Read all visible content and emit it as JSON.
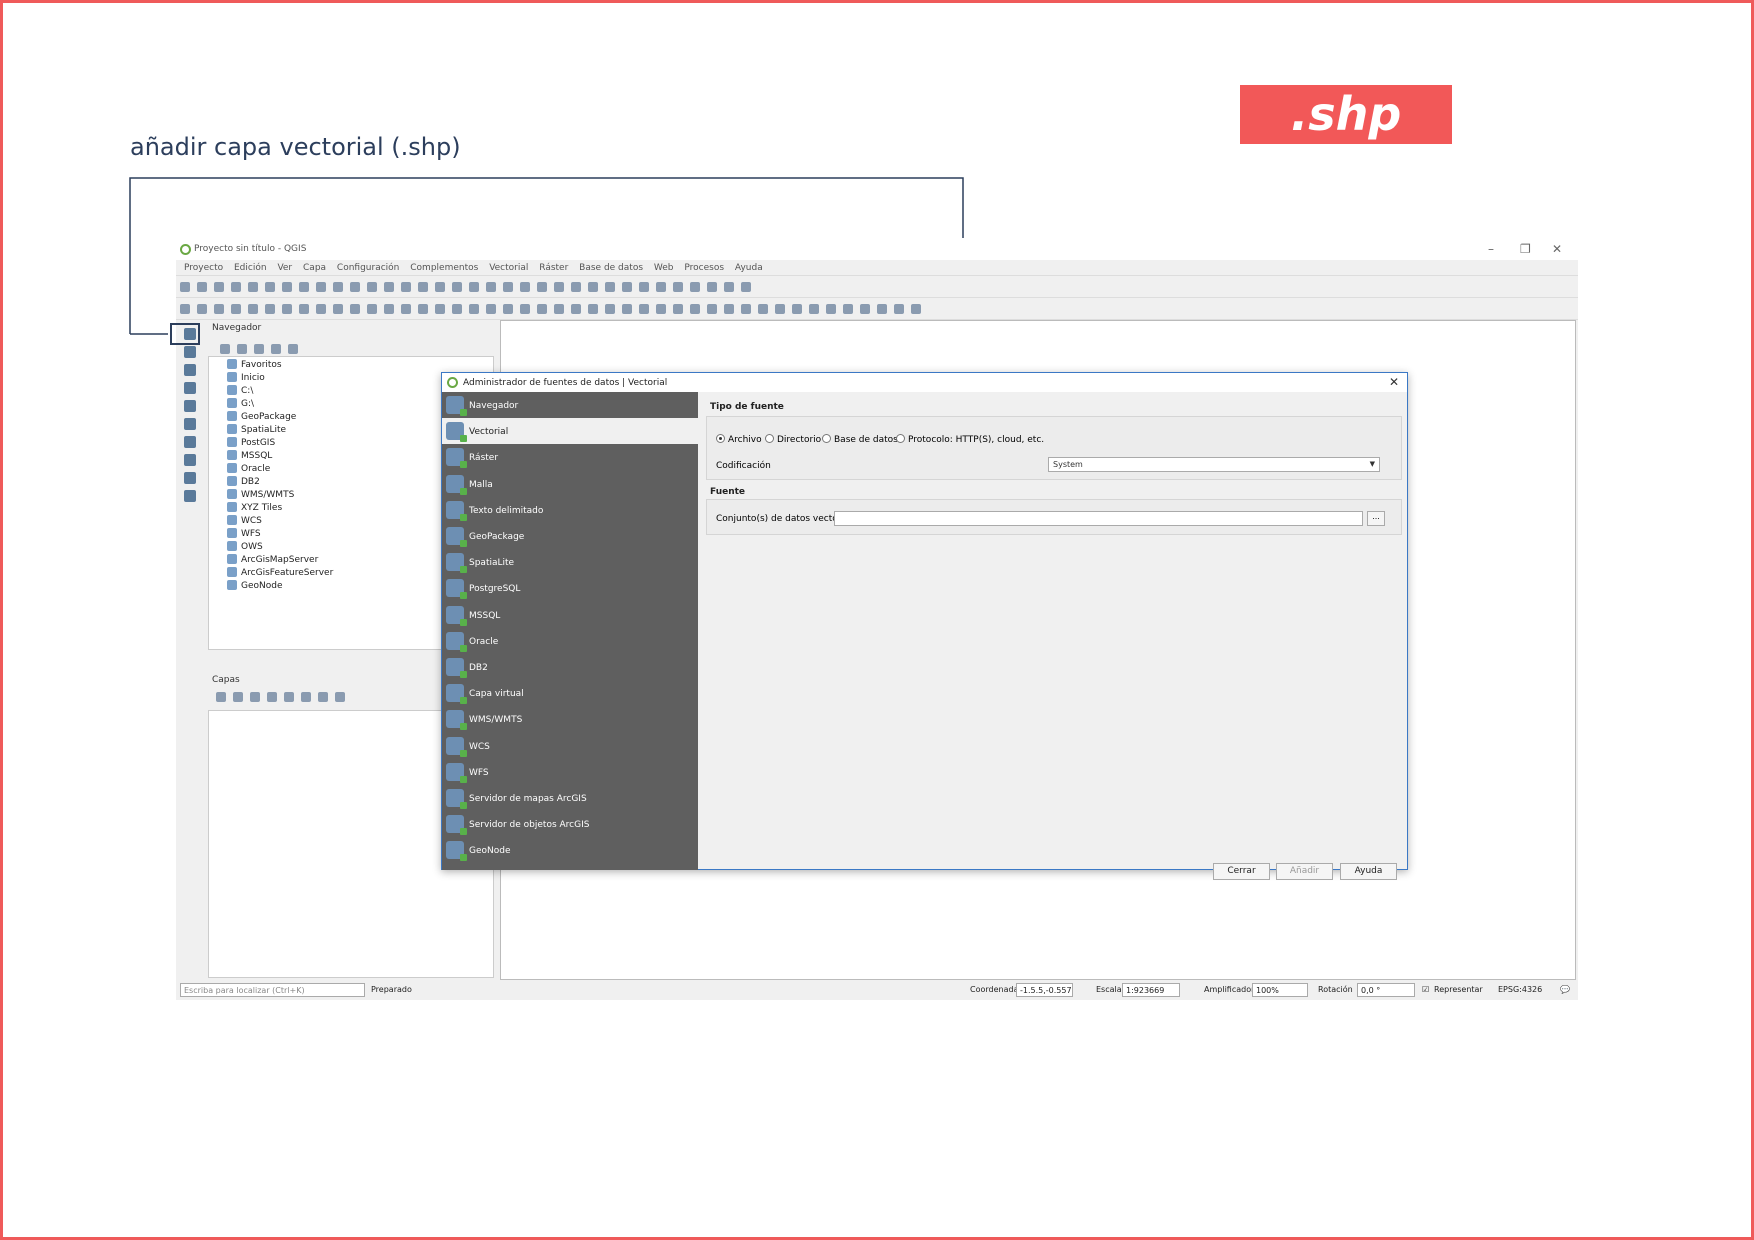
{
  "heading": "añadir capa vectorial (.shp)",
  "badge": ".shp",
  "window": {
    "title": "Proyecto sin título - QGIS",
    "menu": [
      "Proyecto",
      "Edición",
      "Ver",
      "Capa",
      "Configuración",
      "Complementos",
      "Vectorial",
      "Ráster",
      "Base de datos",
      "Web",
      "Procesos",
      "Ayuda"
    ]
  },
  "browser": {
    "title": "Navegador",
    "items": [
      "Favoritos",
      "Inicio",
      "C:\\",
      "G:\\",
      "GeoPackage",
      "SpatiaLite",
      "PostGIS",
      "MSSQL",
      "Oracle",
      "DB2",
      "WMS/WMTS",
      "XYZ Tiles",
      "WCS",
      "WFS",
      "OWS",
      "ArcGisMapServer",
      "ArcGisFeatureServer",
      "GeoNode"
    ]
  },
  "layers": {
    "title": "Capas"
  },
  "status": {
    "search_placeholder": "Escriba para localizar (Ctrl+K)",
    "state": "Preparado",
    "coord_label": "Coordenada",
    "coord_value": "-1.5.5,-0.557",
    "scale_label": "Escala",
    "scale_value": "1:923669",
    "magnifier_label": "Amplificador",
    "magnifier_value": "100%",
    "rotation_label": "Rotación",
    "rotation_value": "0,0 °",
    "render_label": "Representar",
    "crs": "EPSG:4326"
  },
  "dialog": {
    "title": "Administrador de fuentes de datos | Vectorial",
    "sidebar": [
      "Navegador",
      "Vectorial",
      "Ráster",
      "Malla",
      "Texto delimitado",
      "GeoPackage",
      "SpatiaLite",
      "PostgreSQL",
      "MSSQL",
      "Oracle",
      "DB2",
      "Capa virtual",
      "WMS/WMTS",
      "WCS",
      "WFS",
      "Servidor de mapas ArcGIS",
      "Servidor de objetos ArcGIS",
      "GeoNode"
    ],
    "source_type_header": "Tipo de fuente",
    "radio_file": "Archivo",
    "radio_dir": "Directorio",
    "radio_db": "Base de datos",
    "radio_proto": "Protocolo: HTTP(S), cloud, etc.",
    "encoding_label": "Codificación",
    "encoding_value": "System",
    "source_header": "Fuente",
    "dataset_label": "Conjunto(s) de datos vectoriales",
    "browse": "...",
    "close": "Cerrar",
    "add": "Añadir",
    "help": "Ayuda"
  }
}
